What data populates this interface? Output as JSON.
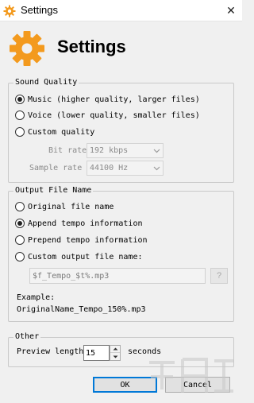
{
  "window": {
    "title": "Settings",
    "app_icon": "gear-icon",
    "close_glyph": "✕"
  },
  "header": {
    "title": "Settings",
    "icon": "gear-icon",
    "icon_color": "#f39a1e"
  },
  "sound_quality": {
    "legend": "Sound Quality",
    "options": [
      {
        "label": "Music (higher quality, larger files)",
        "selected": true
      },
      {
        "label": "Voice (lower quality, smaller files)",
        "selected": false
      },
      {
        "label": "Custom quality",
        "selected": false
      }
    ],
    "bit_rate": {
      "label": "Bit rate",
      "value": "192 kbps",
      "enabled": false
    },
    "sample_rate": {
      "label": "Sample rate",
      "value": "44100 Hz",
      "enabled": false
    }
  },
  "output_file_name": {
    "legend": "Output File Name",
    "options": [
      {
        "label": "Original file name",
        "selected": false
      },
      {
        "label": "Append tempo information",
        "selected": true
      },
      {
        "label": "Prepend tempo information",
        "selected": false
      },
      {
        "label": "Custom output file name:",
        "selected": false
      }
    ],
    "custom_value": "$f_Tempo_$t%.mp3",
    "help_label": "?",
    "example_label": "Example:",
    "example_value": "OriginalName_Tempo_150%.mp3"
  },
  "other": {
    "legend": "Other",
    "preview_label": "Preview length",
    "preview_value": "15",
    "preview_unit": "seconds"
  },
  "buttons": {
    "ok": "OK",
    "cancel": "Cancel"
  },
  "colors": {
    "accent": "#0078d7",
    "gear": "#f39a1e",
    "disabled_text": "#8a8a8a"
  }
}
